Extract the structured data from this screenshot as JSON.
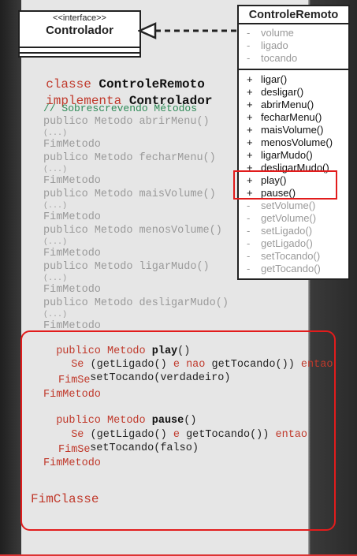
{
  "interface_box": {
    "stereotype": "<<interface>>",
    "name": "Controlador"
  },
  "class_box": {
    "name": "ControleRemoto",
    "attributes": [
      "volume",
      "ligado",
      "tocando"
    ],
    "methods_public": [
      {
        "vis": "+",
        "name": "ligar()"
      },
      {
        "vis": "+",
        "name": "desligar()"
      },
      {
        "vis": "+",
        "name": "abrirMenu()"
      },
      {
        "vis": "+",
        "name": "fecharMenu()"
      },
      {
        "vis": "+",
        "name": "maisVolume()"
      },
      {
        "vis": "+",
        "name": "menosVolume()"
      },
      {
        "vis": "+",
        "name": "ligarMudo()"
      },
      {
        "vis": "+",
        "name": "desligarMudo()"
      },
      {
        "vis": "+",
        "name": "play()"
      },
      {
        "vis": "+",
        "name": "pause()"
      }
    ],
    "methods_private": [
      {
        "vis": "-",
        "name": "setVolume()"
      },
      {
        "vis": "-",
        "name": "getVolume()"
      },
      {
        "vis": "-",
        "name": "setLigado()"
      },
      {
        "vis": "-",
        "name": "getLigado()"
      },
      {
        "vis": "-",
        "name": "setTocando()"
      },
      {
        "vis": "-",
        "name": "getTocando()"
      }
    ]
  },
  "code": {
    "kw_classe": "classe",
    "class_name": "ControleRemoto",
    "kw_implementa": "implementa",
    "iface_name": "Controlador",
    "comment": "// Sobrescrevendo Métodos",
    "kw_publico": "publico",
    "kw_metodo": "Metodo",
    "ellipsis": "(...)",
    "fim_metodo": "FimMetodo",
    "faded_methods": [
      {
        "name": "abrirMenu()"
      },
      {
        "name": "fecharMenu()"
      },
      {
        "name": "maisVolume()"
      },
      {
        "name": "menosVolume()"
      },
      {
        "name": "ligarMudo()"
      },
      {
        "name": "desligarMudo()"
      }
    ],
    "play": {
      "name": "play",
      "parens": "()",
      "se": "Se",
      "cond": "(getLigado()",
      "e": "e",
      "nao": "nao",
      "cond2": "getTocando())",
      "entao": "entao",
      "set_call": "setTocando(",
      "set_val": "verdadeiro",
      "set_close": ")",
      "fim_se": "FimSe",
      "fim": "FimMetodo"
    },
    "pause": {
      "name": "pause",
      "parens": "()",
      "se": "Se",
      "cond": "(getLigado()",
      "e": "e",
      "cond2": "getTocando())",
      "entao": "entao",
      "set_call": "setTocando(",
      "set_val": "falso",
      "set_close": ")",
      "fim_se": "FimSe",
      "fim": "FimMetodo"
    },
    "fim_classe": "FimClasse"
  },
  "colors": {
    "keyword": "#c0392b",
    "comment": "#2e8b57",
    "highlight": "#e21c1c"
  }
}
